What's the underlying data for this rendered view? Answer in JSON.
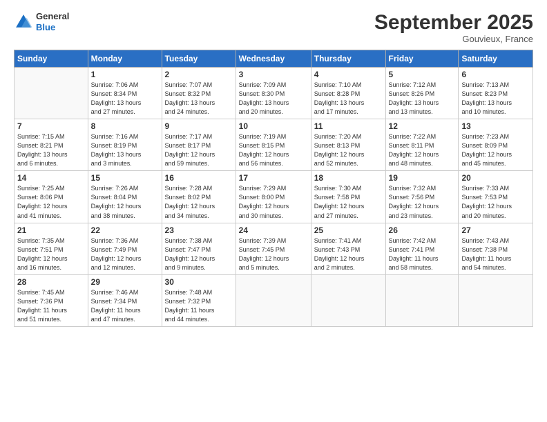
{
  "header": {
    "logo_general": "General",
    "logo_blue": "Blue",
    "month": "September 2025",
    "location": "Gouvieux, France"
  },
  "weekdays": [
    "Sunday",
    "Monday",
    "Tuesday",
    "Wednesday",
    "Thursday",
    "Friday",
    "Saturday"
  ],
  "weeks": [
    [
      {
        "day": "",
        "info": ""
      },
      {
        "day": "1",
        "info": "Sunrise: 7:06 AM\nSunset: 8:34 PM\nDaylight: 13 hours\nand 27 minutes."
      },
      {
        "day": "2",
        "info": "Sunrise: 7:07 AM\nSunset: 8:32 PM\nDaylight: 13 hours\nand 24 minutes."
      },
      {
        "day": "3",
        "info": "Sunrise: 7:09 AM\nSunset: 8:30 PM\nDaylight: 13 hours\nand 20 minutes."
      },
      {
        "day": "4",
        "info": "Sunrise: 7:10 AM\nSunset: 8:28 PM\nDaylight: 13 hours\nand 17 minutes."
      },
      {
        "day": "5",
        "info": "Sunrise: 7:12 AM\nSunset: 8:26 PM\nDaylight: 13 hours\nand 13 minutes."
      },
      {
        "day": "6",
        "info": "Sunrise: 7:13 AM\nSunset: 8:23 PM\nDaylight: 13 hours\nand 10 minutes."
      }
    ],
    [
      {
        "day": "7",
        "info": "Sunrise: 7:15 AM\nSunset: 8:21 PM\nDaylight: 13 hours\nand 6 minutes."
      },
      {
        "day": "8",
        "info": "Sunrise: 7:16 AM\nSunset: 8:19 PM\nDaylight: 13 hours\nand 3 minutes."
      },
      {
        "day": "9",
        "info": "Sunrise: 7:17 AM\nSunset: 8:17 PM\nDaylight: 12 hours\nand 59 minutes."
      },
      {
        "day": "10",
        "info": "Sunrise: 7:19 AM\nSunset: 8:15 PM\nDaylight: 12 hours\nand 56 minutes."
      },
      {
        "day": "11",
        "info": "Sunrise: 7:20 AM\nSunset: 8:13 PM\nDaylight: 12 hours\nand 52 minutes."
      },
      {
        "day": "12",
        "info": "Sunrise: 7:22 AM\nSunset: 8:11 PM\nDaylight: 12 hours\nand 48 minutes."
      },
      {
        "day": "13",
        "info": "Sunrise: 7:23 AM\nSunset: 8:09 PM\nDaylight: 12 hours\nand 45 minutes."
      }
    ],
    [
      {
        "day": "14",
        "info": "Sunrise: 7:25 AM\nSunset: 8:06 PM\nDaylight: 12 hours\nand 41 minutes."
      },
      {
        "day": "15",
        "info": "Sunrise: 7:26 AM\nSunset: 8:04 PM\nDaylight: 12 hours\nand 38 minutes."
      },
      {
        "day": "16",
        "info": "Sunrise: 7:28 AM\nSunset: 8:02 PM\nDaylight: 12 hours\nand 34 minutes."
      },
      {
        "day": "17",
        "info": "Sunrise: 7:29 AM\nSunset: 8:00 PM\nDaylight: 12 hours\nand 30 minutes."
      },
      {
        "day": "18",
        "info": "Sunrise: 7:30 AM\nSunset: 7:58 PM\nDaylight: 12 hours\nand 27 minutes."
      },
      {
        "day": "19",
        "info": "Sunrise: 7:32 AM\nSunset: 7:56 PM\nDaylight: 12 hours\nand 23 minutes."
      },
      {
        "day": "20",
        "info": "Sunrise: 7:33 AM\nSunset: 7:53 PM\nDaylight: 12 hours\nand 20 minutes."
      }
    ],
    [
      {
        "day": "21",
        "info": "Sunrise: 7:35 AM\nSunset: 7:51 PM\nDaylight: 12 hours\nand 16 minutes."
      },
      {
        "day": "22",
        "info": "Sunrise: 7:36 AM\nSunset: 7:49 PM\nDaylight: 12 hours\nand 12 minutes."
      },
      {
        "day": "23",
        "info": "Sunrise: 7:38 AM\nSunset: 7:47 PM\nDaylight: 12 hours\nand 9 minutes."
      },
      {
        "day": "24",
        "info": "Sunrise: 7:39 AM\nSunset: 7:45 PM\nDaylight: 12 hours\nand 5 minutes."
      },
      {
        "day": "25",
        "info": "Sunrise: 7:41 AM\nSunset: 7:43 PM\nDaylight: 12 hours\nand 2 minutes."
      },
      {
        "day": "26",
        "info": "Sunrise: 7:42 AM\nSunset: 7:41 PM\nDaylight: 11 hours\nand 58 minutes."
      },
      {
        "day": "27",
        "info": "Sunrise: 7:43 AM\nSunset: 7:38 PM\nDaylight: 11 hours\nand 54 minutes."
      }
    ],
    [
      {
        "day": "28",
        "info": "Sunrise: 7:45 AM\nSunset: 7:36 PM\nDaylight: 11 hours\nand 51 minutes."
      },
      {
        "day": "29",
        "info": "Sunrise: 7:46 AM\nSunset: 7:34 PM\nDaylight: 11 hours\nand 47 minutes."
      },
      {
        "day": "30",
        "info": "Sunrise: 7:48 AM\nSunset: 7:32 PM\nDaylight: 11 hours\nand 44 minutes."
      },
      {
        "day": "",
        "info": ""
      },
      {
        "day": "",
        "info": ""
      },
      {
        "day": "",
        "info": ""
      },
      {
        "day": "",
        "info": ""
      }
    ]
  ]
}
